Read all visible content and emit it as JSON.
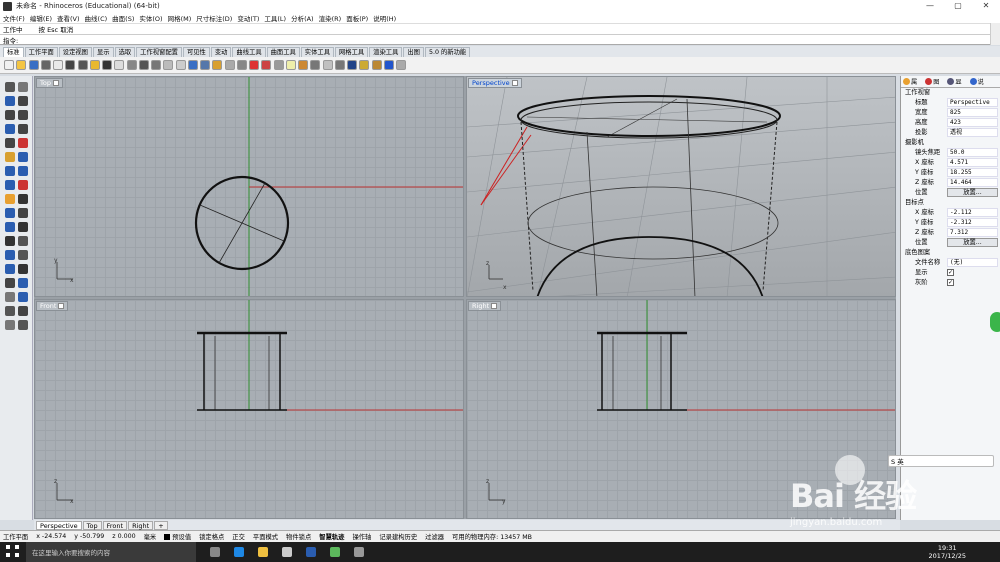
{
  "window": {
    "title": "未命名 - Rhinoceros (Educational) (64-bit)",
    "controls": [
      "—",
      "▢",
      "✕"
    ]
  },
  "menubar": [
    "文件(F)",
    "编辑(E)",
    "查看(V)",
    "曲线(C)",
    "曲面(S)",
    "实体(O)",
    "网格(M)",
    "尺寸标注(D)",
    "变动(T)",
    "工具(L)",
    "分析(A)",
    "渲染(R)",
    "面板(P)",
    "说明(H)"
  ],
  "command": {
    "history_label": "工作中",
    "history_text": "按 Esc 取消",
    "prompt": "指令:",
    "value": ""
  },
  "toolbar_tabs": [
    "标准",
    "工作平面",
    "设定视图",
    "显示",
    "选取",
    "工作视窗配置",
    "可见性",
    "变动",
    "曲线工具",
    "曲面工具",
    "实体工具",
    "网格工具",
    "渲染工具",
    "出图",
    "5.0 的新功能"
  ],
  "toolbar_icons": [
    "new-icon",
    "open-icon",
    "save-icon",
    "print-icon",
    "import-icon",
    "cut-icon",
    "copy-icon",
    "paste-icon",
    "undo-icon",
    "pan-icon",
    "rotate-view-icon",
    "zoom-icon",
    "zoom-window-icon",
    "zoom-extents-icon",
    "zoom-selected-icon",
    "undo-view-icon",
    "viewport-layout-icon",
    "properties-icon",
    "layer-icon",
    "cplane-icon",
    "wireframe-icon",
    "shaded-icon",
    "light-icon",
    "lock-icon",
    "render-icon",
    "material-icon",
    "environment-icon",
    "rendered-sphere-icon",
    "sphere-icon",
    "texture-icon",
    "options-icon",
    "help-icon",
    "extra-icon"
  ],
  "toolbar_colors": [
    "#f0f0f0",
    "#f4c542",
    "#3a6fc4",
    "#666",
    "#e9e9e9",
    "#444",
    "#555",
    "#e8b830",
    "#333",
    "#ddd",
    "#888",
    "#555",
    "#777",
    "#bbb",
    "#ccc",
    "#3a6fc4",
    "#5577aa",
    "#d8a030",
    "#aaa",
    "#888",
    "#dd3333",
    "#c44",
    "#999",
    "#eeeeaa",
    "#cc8833",
    "#777",
    "#c0c0c0",
    "#777",
    "#224488",
    "#ccaa33",
    "#bb8833",
    "#2255cc",
    "#aaa"
  ],
  "viewports": {
    "top": {
      "label": "Top"
    },
    "perspective": {
      "label": "Perspective"
    },
    "front": {
      "label": "Front"
    },
    "right": {
      "label": "Right"
    }
  },
  "viewport_tabs": [
    "Perspective",
    "Top",
    "Front",
    "Right",
    "+"
  ],
  "properties_panel": {
    "tabs": [
      "属",
      "图",
      "显",
      "说"
    ],
    "section_viewport": "工作视窗",
    "title_label": "标题",
    "title_value": "Perspective",
    "width_label": "宽度",
    "width_value": "825",
    "height_label": "高度",
    "height_value": "423",
    "projection_label": "投影",
    "projection_value": "透视",
    "section_camera": "摄影机",
    "lens_label": "镜头焦距",
    "lens_value": "50.0",
    "cam_x_label": "X 座标",
    "cam_x_value": "4.571",
    "cam_y_label": "Y 座标",
    "cam_y_value": "18.255",
    "cam_z_label": "Z 座标",
    "cam_z_value": "14.464",
    "cam_pos_label": "位置",
    "cam_pos_button": "放置...",
    "section_target": "目标点",
    "tgt_x_label": "X 座标",
    "tgt_x_value": "-2.112",
    "tgt_y_label": "Y 座标",
    "tgt_y_value": "-2.312",
    "tgt_z_label": "Z 座标",
    "tgt_z_value": "7.312",
    "tgt_pos_label": "位置",
    "tgt_pos_button": "放置...",
    "section_bg": "底色图案",
    "file_label": "文件名称",
    "file_value": "(无)",
    "show_label": "显示",
    "gray_label": "灰阶"
  },
  "statusbar": {
    "cplane": "工作平面",
    "x": "x -24.574",
    "y": "y -50.799",
    "z": "z 0.000",
    "unit": "毫米",
    "layer": "预设值",
    "toggles": [
      "锁定格点",
      "正交",
      "平面模式",
      "物件锁点",
      "智慧轨迹",
      "操作轴",
      "记录建构历史",
      "过滤器"
    ],
    "memory": "可用的物理内存: 13457 MB"
  },
  "taskbar": {
    "search_placeholder": "在这里输入你要搜索的内容",
    "time": "19:31",
    "date": "2017/12/25"
  },
  "watermark": {
    "brand": "Bai 经验",
    "url": "jingyan.baidu.com"
  },
  "ime": {
    "label": "S 英"
  }
}
